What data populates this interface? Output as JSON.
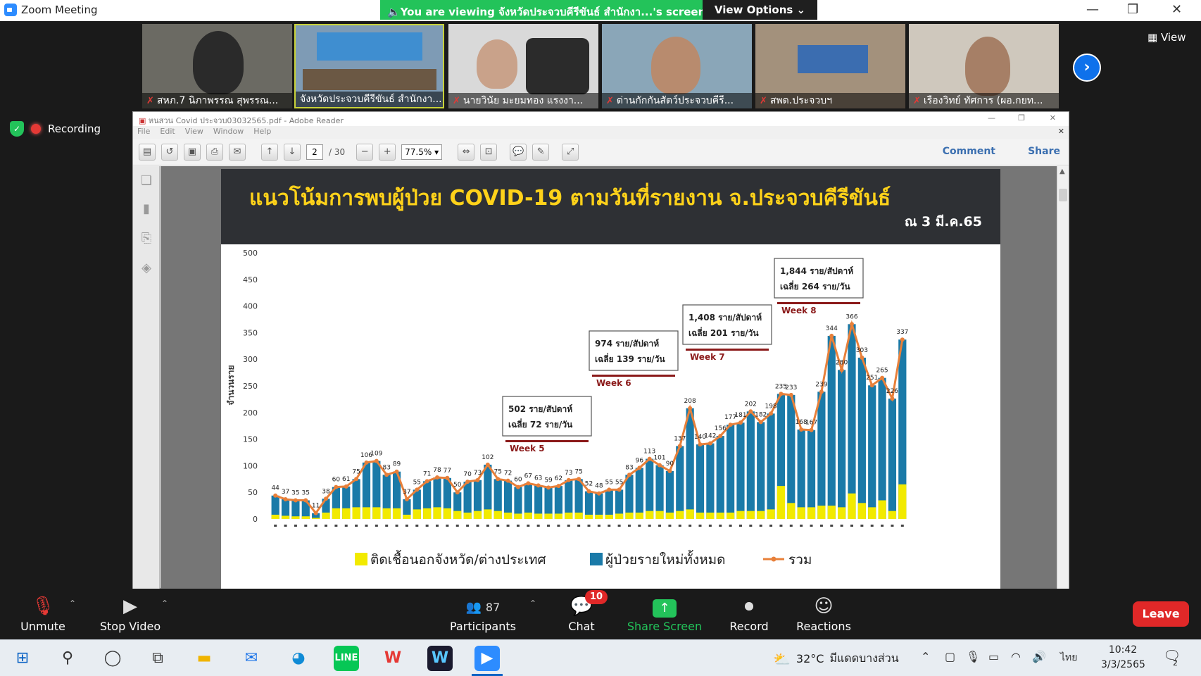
{
  "window": {
    "title": "Zoom Meeting",
    "banner": "You are viewing จังหวัดประจวบคีรีขันธ์ สำนักงา...'s screen",
    "view_options": "View Options ⌄"
  },
  "gallery": {
    "participants": [
      {
        "name": "สหภ.7 นิภาพรรณ สุพรรณ...",
        "muted": true
      },
      {
        "name": "จังหวัดประจวบคีรีขันธ์ สำนักงา...",
        "muted": false
      },
      {
        "name": "นายวินัย มะยมทอง  แรงงา...",
        "muted": true
      },
      {
        "name": "ด่านกักกันสัตว์ประจวบคีรี...",
        "muted": true
      },
      {
        "name": "สพด.ประจวบฯ",
        "muted": true
      },
      {
        "name": "เรืองวิทย์ ทัศการ (ผอ.กยท...",
        "muted": true
      }
    ],
    "view_label": "View"
  },
  "recording_label": "Recording",
  "reader": {
    "title": "หนสวน Covid ประจวบ03032565.pdf - Adobe Reader",
    "menu": [
      "File",
      "Edit",
      "View",
      "Window",
      "Help"
    ],
    "page_current": "2",
    "page_total": "/ 30",
    "zoom": "77.5%",
    "comment": "Comment",
    "share": "Share"
  },
  "slide": {
    "title": "แนวโน้มการพบผู้ป่วย COVID-19 ตามวันที่รายงาน จ.ประจวบคีรีขันธ์",
    "subtitle": "ณ 3 มี.ค.65",
    "ylabel": "จำนวนราย",
    "callouts": [
      {
        "line1": "502 ราย/สัปดาห์",
        "line2": "เฉลี่ย 72 ราย/วัน",
        "week": "Week 5"
      },
      {
        "line1": "974 ราย/สัปดาห์",
        "line2": "เฉลี่ย 139 ราย/วัน",
        "week": "Week 6"
      },
      {
        "line1": "1,408 ราย/สัปดาห์",
        "line2": "เฉลี่ย 201 ราย/วัน",
        "week": "Week 7"
      },
      {
        "line1": "1,844 ราย/สัปดาห์",
        "line2": "เฉลี่ย 264 ราย/วัน",
        "week": "Week 8"
      }
    ],
    "legend": [
      "ติดเชื้อนอกจังหวัด/ต่างประเทศ",
      "ผู้ป่วยรายใหม่ทั้งหมด",
      "รวม"
    ]
  },
  "chart_data": {
    "type": "bar",
    "ylim": [
      0,
      500
    ],
    "yticks": [
      0,
      50,
      100,
      150,
      200,
      250,
      300,
      350,
      400,
      450,
      500
    ],
    "series": [
      {
        "name": "ผู้ป่วยรายใหม่ทั้งหมด",
        "color": "#1a7aa8",
        "values": [
          44,
          37,
          35,
          35,
          11,
          38,
          60,
          61,
          75,
          106,
          109,
          83,
          89,
          37,
          55,
          71,
          78,
          77,
          50,
          70,
          73,
          102,
          75,
          72,
          60,
          67,
          63,
          59,
          62,
          73,
          75,
          52,
          48,
          55,
          55,
          83,
          96,
          113,
          101,
          90,
          137,
          208,
          140,
          142,
          156,
          177,
          181,
          202,
          182,
          198,
          235,
          233,
          168,
          167,
          239,
          344,
          280,
          366,
          303,
          251,
          265,
          226,
          337
        ]
      },
      {
        "name": "ติดเชื้อนอกจังหวัด/ต่างประเทศ",
        "color": "#f2ea00",
        "values": [
          8,
          6,
          5,
          5,
          2,
          12,
          20,
          20,
          22,
          22,
          22,
          20,
          20,
          8,
          18,
          20,
          22,
          20,
          15,
          12,
          15,
          18,
          15,
          12,
          10,
          12,
          10,
          10,
          10,
          12,
          12,
          8,
          8,
          8,
          10,
          12,
          12,
          15,
          15,
          12,
          15,
          18,
          12,
          12,
          12,
          12,
          15,
          15,
          15,
          18,
          62,
          30,
          22,
          22,
          25,
          25,
          22,
          48,
          30,
          22,
          35,
          15,
          65
        ]
      },
      {
        "name": "รวม",
        "color": "#e8803a",
        "values": [
          44,
          37,
          35,
          35,
          11,
          38,
          60,
          61,
          75,
          106,
          109,
          83,
          89,
          37,
          55,
          71,
          78,
          77,
          50,
          70,
          73,
          102,
          75,
          72,
          60,
          67,
          63,
          59,
          62,
          73,
          75,
          52,
          48,
          55,
          55,
          83,
          96,
          113,
          101,
          90,
          137,
          208,
          140,
          142,
          156,
          177,
          181,
          202,
          182,
          198,
          235,
          233,
          168,
          167,
          239,
          344,
          280,
          366,
          303,
          251,
          265,
          226,
          337
        ]
      }
    ],
    "data_labels": [
      "44",
      "37",
      "35",
      "35",
      "11",
      "38",
      "60",
      "61",
      "75",
      "106",
      "109",
      "83",
      "89",
      "37",
      "55",
      "71",
      "78",
      "77",
      "50",
      "70",
      "73",
      "102",
      "75",
      "72",
      "60",
      "67",
      "63",
      "59",
      "62",
      "73",
      "75",
      "52",
      "48",
      "55",
      "55",
      "83",
      "96",
      "113",
      "101",
      "90",
      "137",
      "208",
      "140",
      "142",
      "156",
      "177",
      "181",
      "202",
      "182",
      "198",
      "235",
      "233",
      "168",
      "167",
      "239",
      "344",
      "280",
      "366",
      "303",
      "251",
      "265",
      "226",
      "337"
    ]
  },
  "toolbar": {
    "unmute": "Unmute",
    "stop_video": "Stop Video",
    "participants": "Participants",
    "participants_count": "87",
    "chat": "Chat",
    "chat_badge": "10",
    "share_screen": "Share Screen",
    "record": "Record",
    "reactions": "Reactions",
    "leave": "Leave"
  },
  "taskbar": {
    "weather_temp": "32°C",
    "weather_text": "มีแดดบางส่วน",
    "lang": "ไทย",
    "time": "10:42",
    "date": "3/3/2565",
    "notif_count": "2"
  }
}
